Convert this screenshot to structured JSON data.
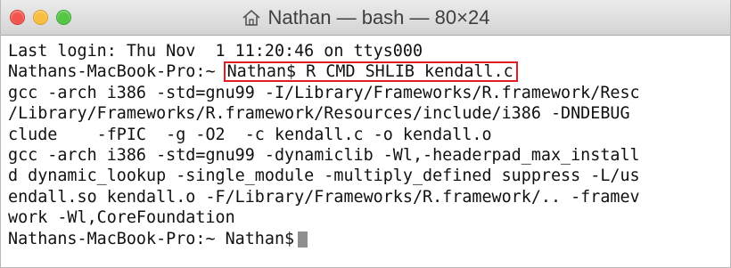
{
  "window": {
    "title": "Nathan — bash — 80×24",
    "title_icon": "home-icon",
    "colors": {
      "close": "#f2554e",
      "minimize": "#f9be3f",
      "zoom": "#54c643",
      "highlight": "#e11d24"
    }
  },
  "terminal": {
    "lines": [
      "Last login: Thu Nov  1 11:20:46 on ttys000",
      "gcc -arch i386 -std=gnu99 -I/Library/Frameworks/R.framework/Resc",
      "/Library/Frameworks/R.framework/Resources/include/i386 -DNDEBUG",
      "clude    -fPIC  -g -O2  -c kendall.c -o kendall.o",
      "gcc -arch i386 -std=gnu99 -dynamiclib -Wl,-headerpad_max_install",
      "d dynamic_lookup -single_module -multiply_defined suppress -L/us",
      "endall.so kendall.o -F/Library/Frameworks/R.framework/.. -framev",
      "work -Wl,CoreFoundation"
    ],
    "command_prompt": "Nathans-MacBook-Pro:~ ",
    "command": "Nathan$ R CMD SHLIB kendall.c",
    "final_prompt": "Nathans-MacBook-Pro:~ Nathan$"
  }
}
